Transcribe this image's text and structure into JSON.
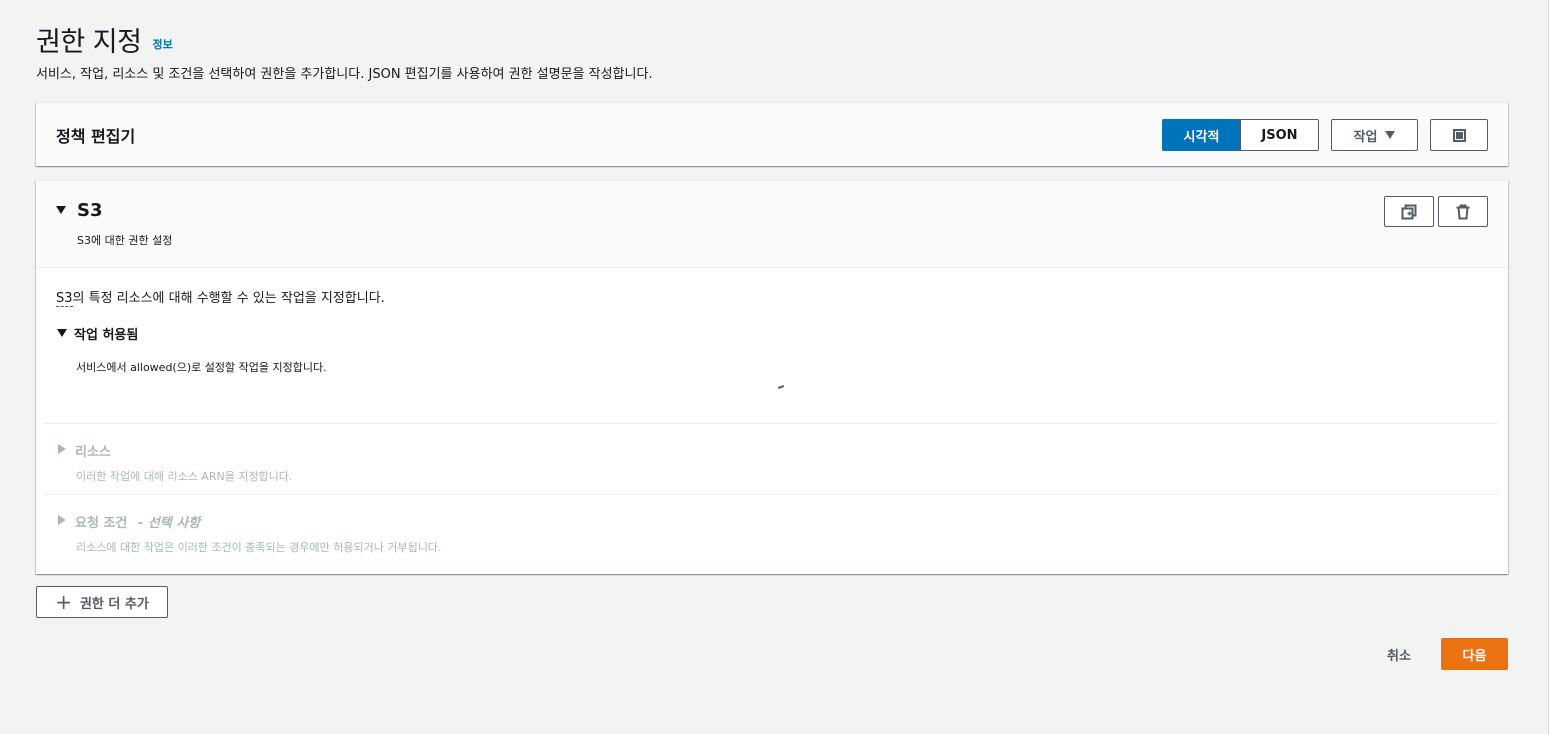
{
  "page": {
    "title": "권한 지정",
    "info_link": "정보",
    "description": "서비스, 작업, 리소스 및 조건을 선택하여 권한을 추가합니다. JSON 편집기를 사용하여 권한 설명문을 작성합니다."
  },
  "policy_editor": {
    "title": "정책 편집기",
    "mode_visual": "시각적",
    "mode_json": "JSON",
    "selected_mode": "시각적",
    "actions_label": "작업",
    "fullscreen_icon": "fullscreen-icon"
  },
  "statement": {
    "service": "S3",
    "subtitle": "S3에 대한 권한 설정",
    "intro_service": "S3",
    "intro_rest": "의 특정 리소스에 대해 수행할 수 있는 작업을 지정합니다.",
    "duplicate_icon": "duplicate-icon",
    "delete_icon": "trash-icon",
    "sections": {
      "actions": {
        "title": "작업 허용됨",
        "description": "서비스에서 allowed(으)로 설정할 작업을 지정합니다.",
        "expanded": true
      },
      "resources": {
        "title": "리소스",
        "description": "이러한 작업에 대해 리소스 ARN을 지정합니다.",
        "expanded": false
      },
      "conditions": {
        "title": "요청 조건",
        "optional": "- 선택 사항",
        "description": "리소스에 대한 작업은 이러한 조건이 충족되는 경우에만 허용되거나 거부됩니다.",
        "expanded": false
      }
    }
  },
  "footer": {
    "add_more": "권한 더 추가",
    "cancel": "취소",
    "next": "다음"
  },
  "colors": {
    "primary": "#0073bb",
    "next_button": "#ec7211",
    "background": "#f2f3f3"
  }
}
